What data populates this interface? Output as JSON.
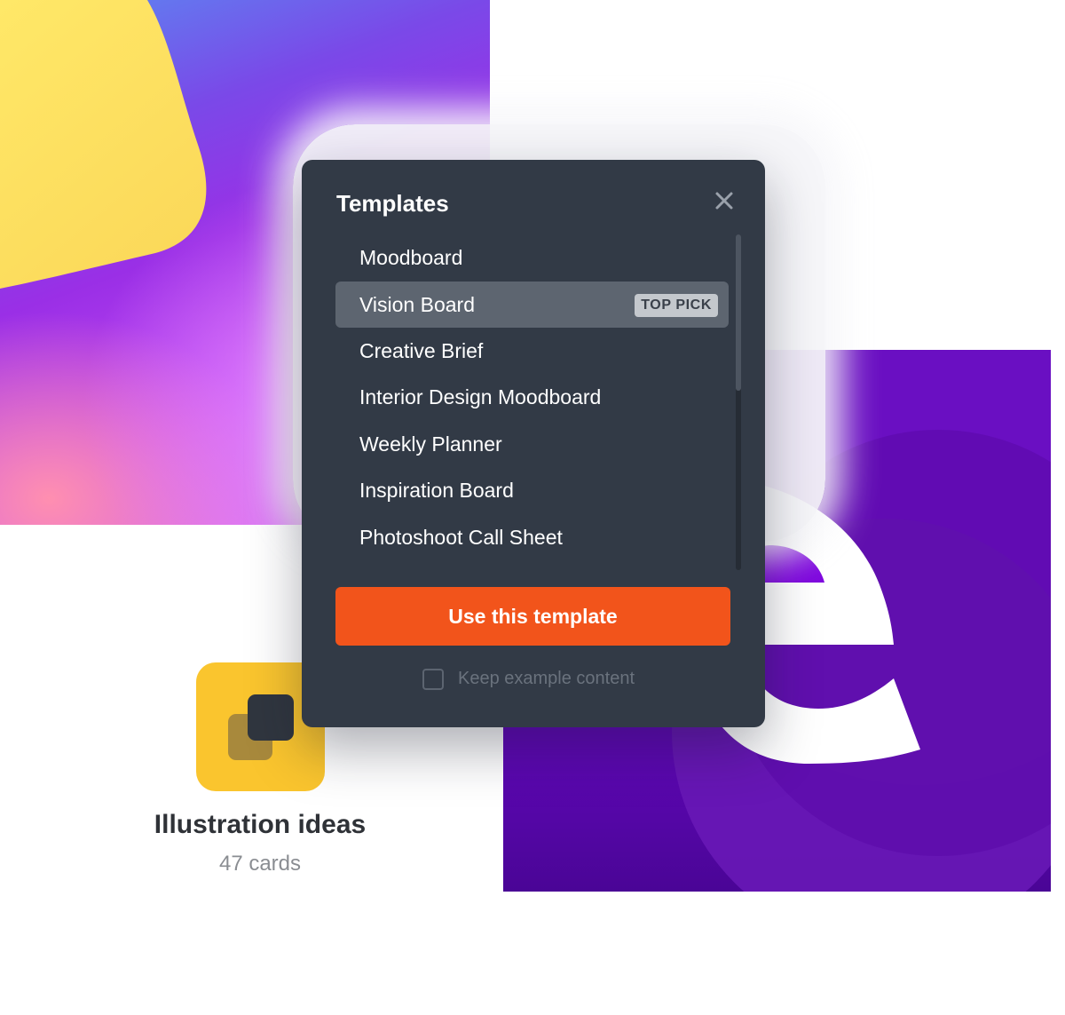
{
  "modal": {
    "title": "Templates",
    "close_icon": "close-icon",
    "templates": [
      {
        "label": "Moodboard"
      },
      {
        "label": "Vision Board",
        "badge": "TOP PICK",
        "selected": true
      },
      {
        "label": "Creative Brief"
      },
      {
        "label": "Interior Design Moodboard"
      },
      {
        "label": "Weekly Planner"
      },
      {
        "label": "Inspiration Board"
      },
      {
        "label": "Photoshoot Call Sheet"
      }
    ],
    "use_button_label": "Use this template",
    "keep_example_label": "Keep example content",
    "keep_example_checked": false
  },
  "board_card": {
    "title": "Illustration ideas",
    "count": "47 cards",
    "icon": "board-icon"
  },
  "colors": {
    "modal_bg": "#323a46",
    "selected_item_bg": "#5d6570",
    "primary_button": "#f2541b",
    "badge_bg": "#c4c8cd",
    "board_icon_bg": "#fac52e",
    "purple_art": "#8a04ea"
  }
}
